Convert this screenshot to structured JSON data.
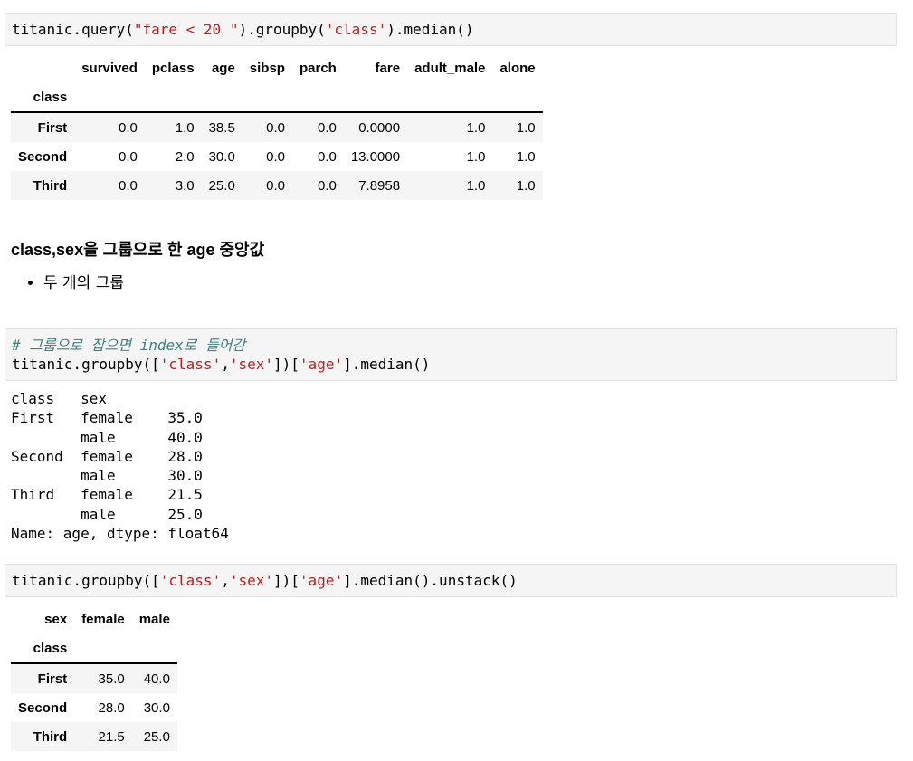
{
  "cell1": {
    "code_prefix": "titanic.query(",
    "code_str1": "\"fare < 20 \"",
    "code_mid": ").groupby(",
    "code_str2": "'class'",
    "code_suffix": ").median()"
  },
  "table1": {
    "columns": [
      "survived",
      "pclass",
      "age",
      "sibsp",
      "parch",
      "fare",
      "adult_male",
      "alone"
    ],
    "index_name": "class",
    "rows": [
      {
        "label": "First",
        "values": [
          "0.0",
          "1.0",
          "38.5",
          "0.0",
          "0.0",
          "0.0000",
          "1.0",
          "1.0"
        ]
      },
      {
        "label": "Second",
        "values": [
          "0.0",
          "2.0",
          "30.0",
          "0.0",
          "0.0",
          "13.0000",
          "1.0",
          "1.0"
        ]
      },
      {
        "label": "Third",
        "values": [
          "0.0",
          "3.0",
          "25.0",
          "0.0",
          "0.0",
          "7.8958",
          "1.0",
          "1.0"
        ]
      }
    ]
  },
  "markdown": {
    "heading": "class,sex을 그룹으로 한 age 중앙값",
    "bullets": [
      "두 개의 그룹"
    ]
  },
  "cell2": {
    "comment": "# 그룹으로 잡으면 index로 들어감",
    "code_prefix": "titanic.groupby([",
    "code_str1": "'class'",
    "code_comma": ",",
    "code_str2": "'sex'",
    "code_mid": "])[",
    "code_str3": "'age'",
    "code_suffix": "].median()"
  },
  "series_output": {
    "lines": [
      "class   sex",
      "First   female    35.0",
      "        male      40.0",
      "Second  female    28.0",
      "        male      30.0",
      "Third   female    21.5",
      "        male      25.0",
      "Name: age, dtype: float64"
    ]
  },
  "cell3": {
    "code_prefix": "titanic.groupby([",
    "code_str1": "'class'",
    "code_comma": ",",
    "code_str2": "'sex'",
    "code_mid": "])[",
    "code_str3": "'age'",
    "code_suffix": "].median().unstack()"
  },
  "table2": {
    "columns_name": "sex",
    "columns": [
      "female",
      "male"
    ],
    "index_name": "class",
    "rows": [
      {
        "label": "First",
        "values": [
          "35.0",
          "40.0"
        ]
      },
      {
        "label": "Second",
        "values": [
          "28.0",
          "30.0"
        ]
      },
      {
        "label": "Third",
        "values": [
          "21.5",
          "25.0"
        ]
      }
    ]
  }
}
